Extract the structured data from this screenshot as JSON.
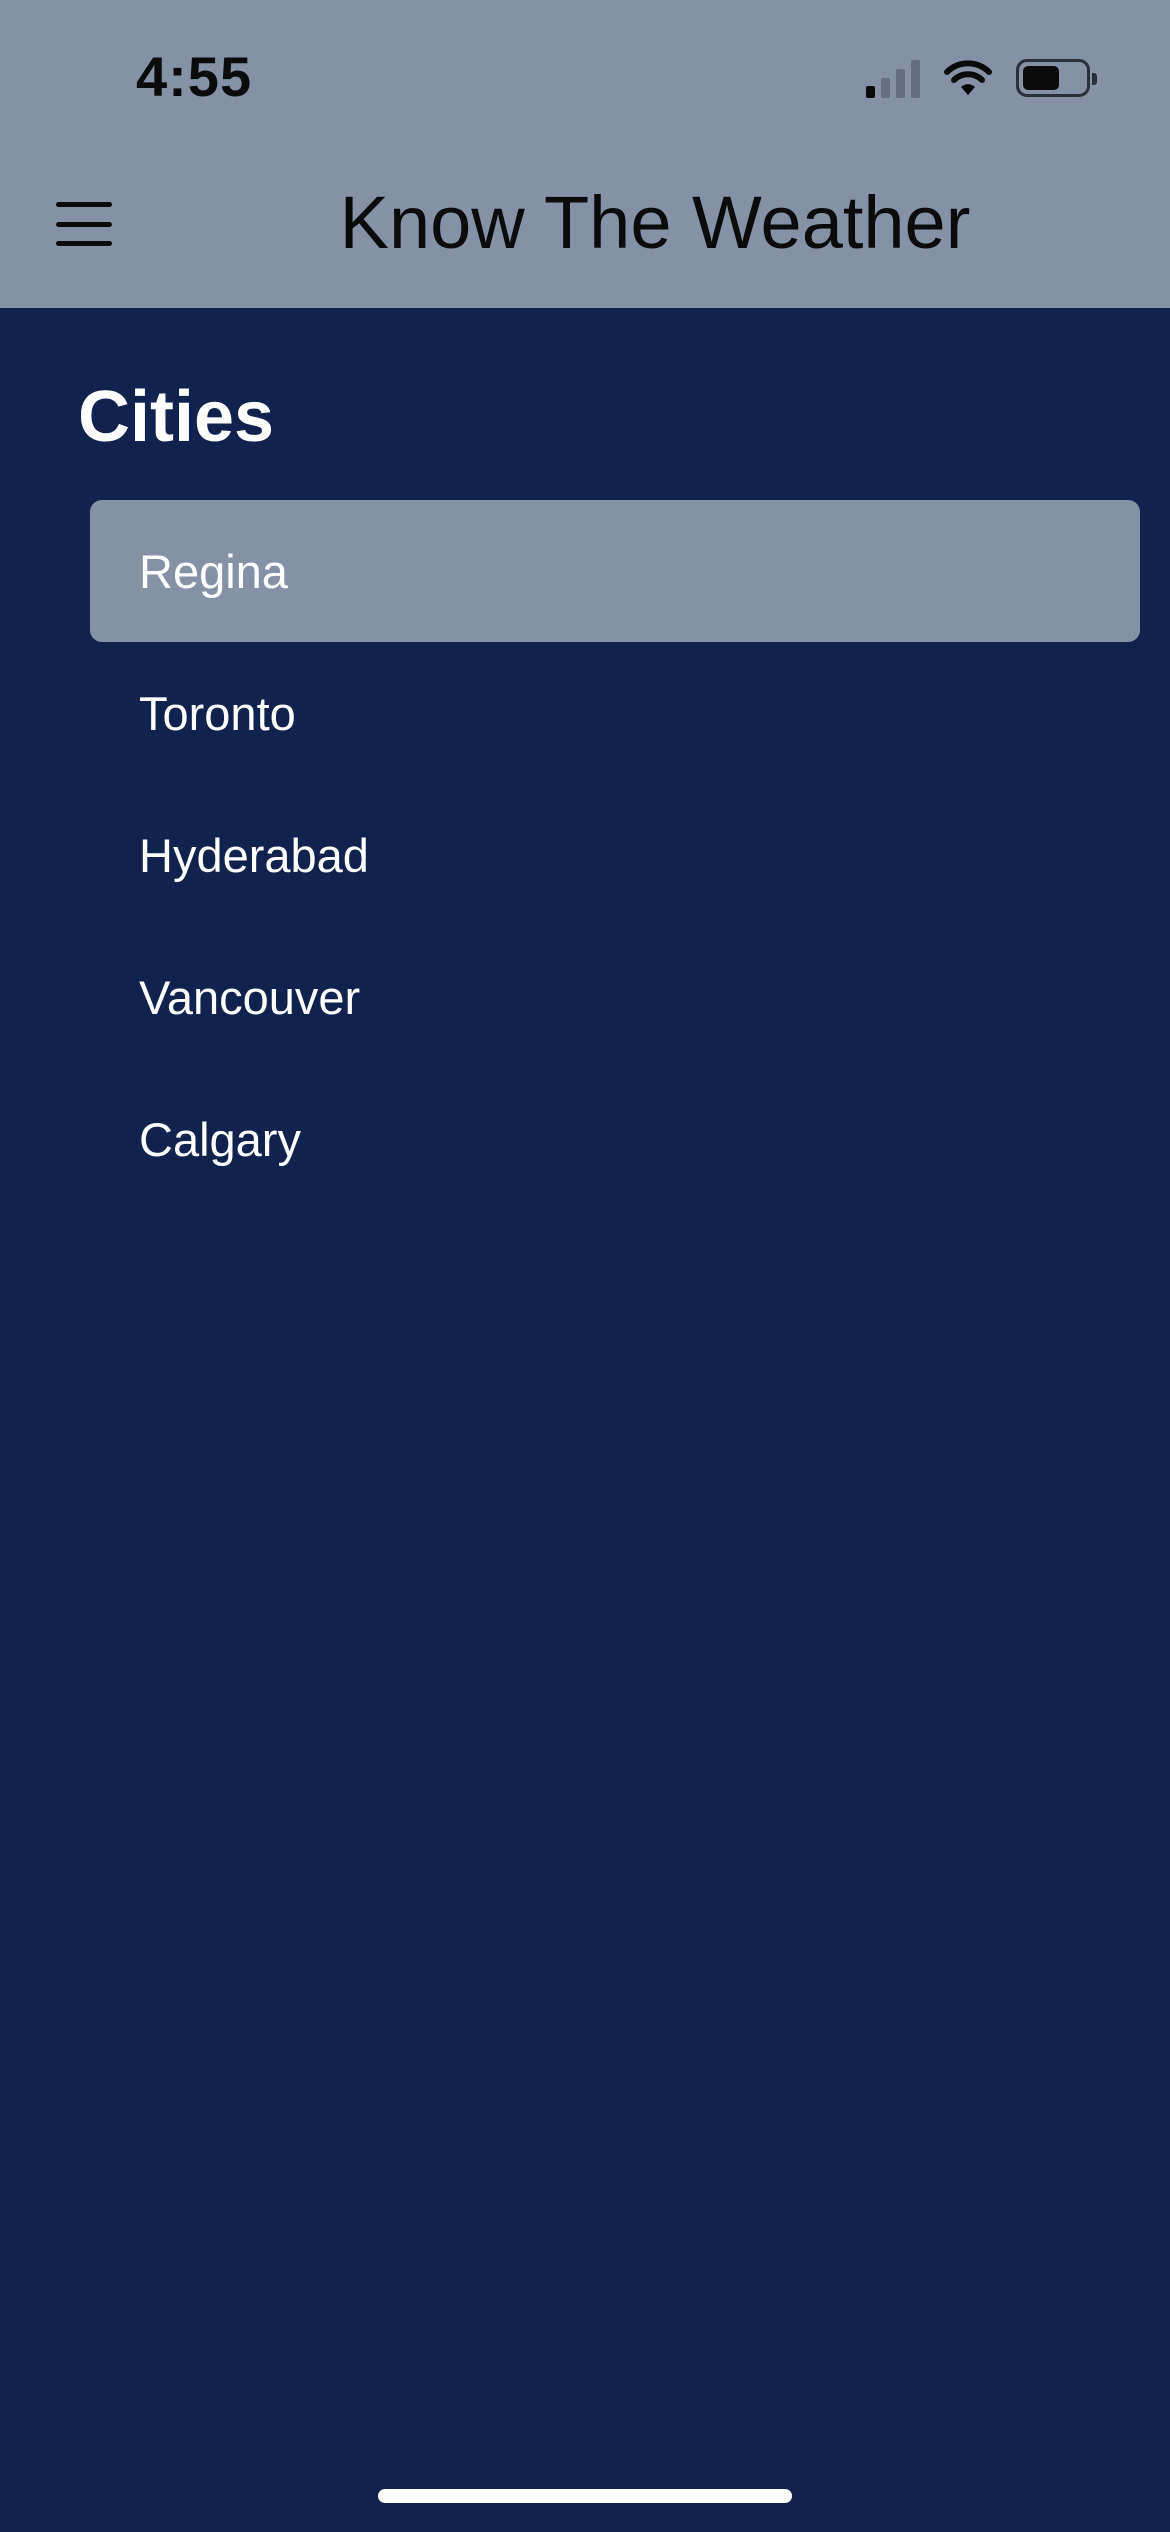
{
  "status_bar": {
    "time": "4:55",
    "signal_icon": "cellular-signal-icon",
    "wifi_icon": "wifi-icon",
    "battery_icon": "battery-icon",
    "battery_level": 0.5
  },
  "header": {
    "title": "Know The Weather",
    "menu_icon": "hamburger-menu-icon"
  },
  "drawer": {
    "section_title": "Cities",
    "selected_index": 0,
    "cities": [
      {
        "label": "Regina"
      },
      {
        "label": "Toronto"
      },
      {
        "label": "Hyderabad"
      },
      {
        "label": "Vancouver"
      },
      {
        "label": "Calgary"
      }
    ]
  },
  "colors": {
    "header_background": "#8592a6",
    "drawer_background": "#12224f",
    "selected_item_background": "#8592a6",
    "text_on_dark": "#ffffff",
    "text_on_light": "#0b0b0b"
  }
}
